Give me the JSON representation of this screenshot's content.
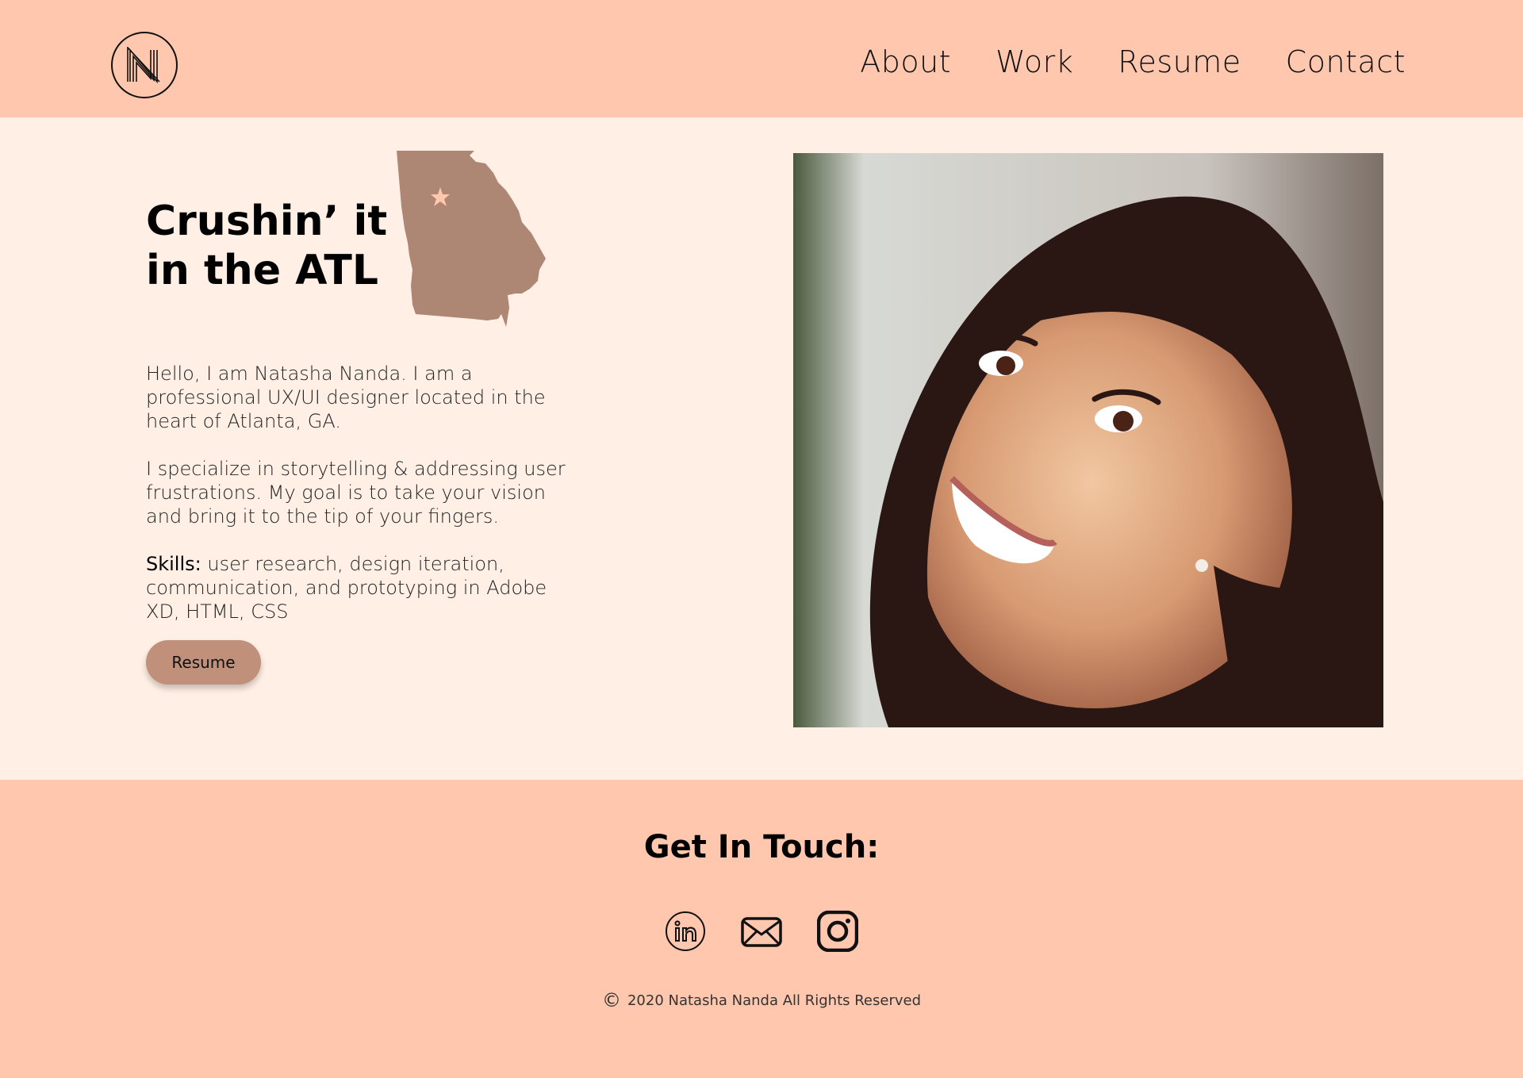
{
  "header": {
    "logo_letter": "N",
    "nav": [
      "About",
      "Work",
      "Resume",
      "Contact"
    ]
  },
  "hero": {
    "title_line1": "Crushin’ it",
    "title_line2": "in the ATL",
    "intro": "Hello, I am Natasha Nanda. I am a professional UX/UI designer located in the heart of Atlanta, GA.",
    "specialty": "I specialize in storytelling & addressing user frustrations. My goal is to take your vision and bring it to the tip of your fingers.",
    "skills_label": "Skills:",
    "skills_text": " user research, design iteration, communication, and prototyping in Adobe XD, HTML, CSS",
    "resume_button": "Resume",
    "map_icon": "georgia-state-map",
    "photo_icon": "profile-portrait"
  },
  "footer": {
    "heading": "Get In Touch:",
    "socials": [
      "linkedin-icon",
      "email-icon",
      "instagram-icon"
    ],
    "copyright_symbol": "©",
    "copyright_text": "2020 Natasha Nanda All Rights Reserved"
  },
  "colors": {
    "header_bg": "#FFC7AE",
    "hero_bg": "#FFEFE5",
    "map_fill": "#AE8774",
    "button_bg": "#C1907A",
    "star": "#FFC7AE"
  }
}
